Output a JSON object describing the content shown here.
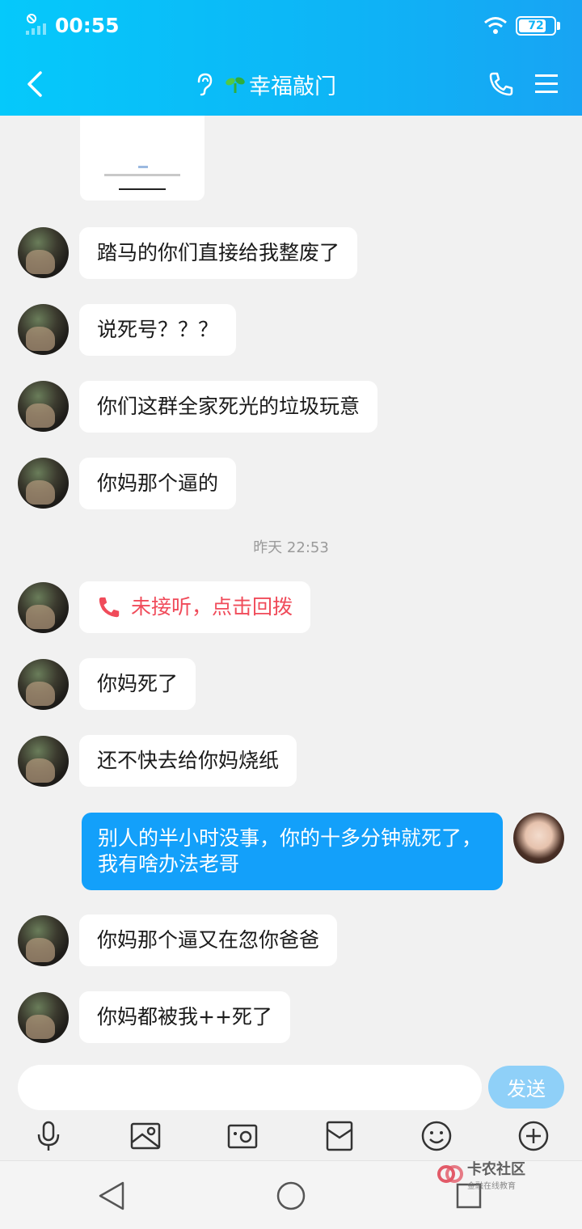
{
  "status_bar": {
    "time": "00:55",
    "battery": "72"
  },
  "header": {
    "title": "幸福敲门"
  },
  "messages": [
    {
      "text": "踏马的你们直接给我整废了"
    },
    {
      "text": "说死号？？？"
    },
    {
      "text": "你们这群全家死光的垃圾玩意"
    },
    {
      "text": "你妈那个逼的"
    },
    {
      "timestamp": "昨天 22:53"
    },
    {
      "text": "未接听，点击回拨"
    },
    {
      "text": "你妈死了"
    },
    {
      "text": "还不快去给你妈烧纸"
    },
    {
      "text": "别人的半小时没事，你的十多分钟就死了，我有啥办法老哥"
    },
    {
      "text": "你妈那个逼又在忽你爸爸"
    },
    {
      "text": "你妈都被我++死了"
    }
  ],
  "input": {
    "placeholder": "",
    "send_label": "发送"
  },
  "watermark": {
    "title": "卡农社区",
    "subtitle": "金融在线教育"
  },
  "colors": {
    "header": "#0eb4f6",
    "my_bubble": "#13a0fa",
    "missed_call": "#f04b5a"
  }
}
